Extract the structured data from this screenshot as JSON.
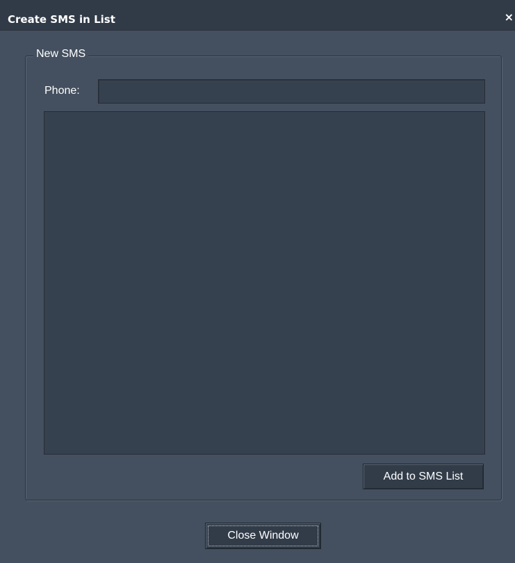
{
  "window": {
    "title": "Create SMS in List",
    "close_glyph": "×",
    "close_icon": "close-icon"
  },
  "group": {
    "legend": "New SMS"
  },
  "phone": {
    "label": "Phone:",
    "value": "",
    "placeholder": ""
  },
  "message": {
    "value": ""
  },
  "buttons": {
    "add_label": "Add to SMS List",
    "close_label": "Close Window"
  },
  "colors": {
    "background": "#44505f",
    "titlebar": "#313b48",
    "field": "#36414f",
    "button": "#323c49",
    "text": "#ffffff"
  }
}
